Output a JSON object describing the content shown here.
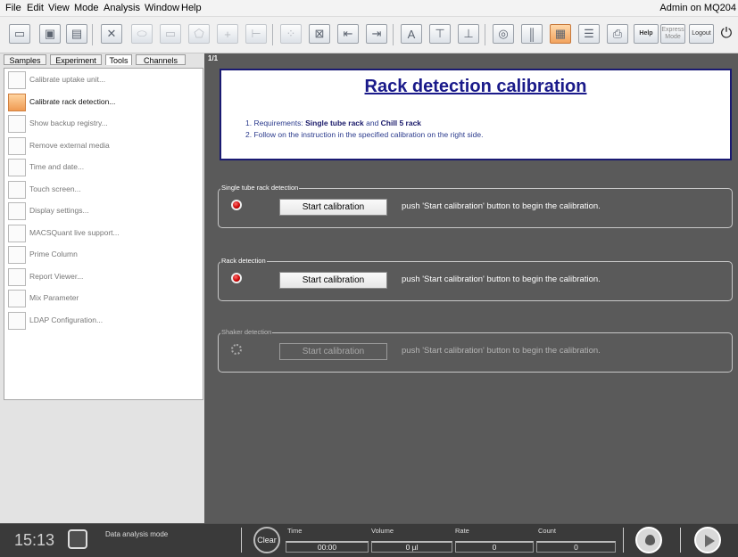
{
  "menu": {
    "items": [
      "File",
      "Edit",
      "View",
      "Mode",
      "Analysis",
      "Window",
      "Help"
    ],
    "user": "Admin on MQ204"
  },
  "toolbar": {
    "help_label": "Help",
    "express_label": "Express Mode",
    "logout_label": "Logout"
  },
  "tabs": [
    {
      "label": "Samples",
      "selected": false
    },
    {
      "label": "Experiment",
      "selected": false
    },
    {
      "label": "Tools",
      "selected": true
    },
    {
      "label": "Channels",
      "selected": false
    }
  ],
  "tools": [
    {
      "label": "Calibrate uptake unit...",
      "selected": false
    },
    {
      "label": "Calibrate rack detection...",
      "selected": true
    },
    {
      "label": "Show backup registry...",
      "selected": false
    },
    {
      "label": "Remove external media",
      "selected": false
    },
    {
      "label": "Time and date...",
      "selected": false
    },
    {
      "label": "Touch screen...",
      "selected": false
    },
    {
      "label": "Display settings...",
      "selected": false
    },
    {
      "label": "MACSQuant live support...",
      "selected": false
    },
    {
      "label": "Prime Column",
      "selected": false
    },
    {
      "label": "Report Viewer...",
      "selected": false
    },
    {
      "label": "Mix Parameter",
      "selected": false
    },
    {
      "label": "LDAP Configuration...",
      "selected": false
    }
  ],
  "main": {
    "page": "1/1",
    "title": "Rack detection calibration",
    "req_prefix": "1. Requirements: ",
    "req_item1": "Single tube rack",
    "req_and": " and ",
    "req_item2": "Chill 5 rack",
    "step2": "2. Follow on the instruction in the specified calibration on the right side.",
    "groups": [
      {
        "title": "Single tube rack detection",
        "button": "Start calibration",
        "message": "push 'Start calibration' button to begin the calibration.",
        "enabled": true
      },
      {
        "title": "Rack detection",
        "button": "Start calibration",
        "message": "push 'Start calibration' button to begin the calibration.",
        "enabled": true
      },
      {
        "title": "Shaker detection",
        "button": "Start calibration",
        "message": "push 'Start calibration' button to begin the calibration.",
        "enabled": false
      }
    ]
  },
  "status": {
    "time": "15:13",
    "mode": "Data analysis mode",
    "clear": "Clear",
    "meters": [
      {
        "label": "Time",
        "value": "00:00"
      },
      {
        "label": "Volume",
        "value": "0 µl"
      },
      {
        "label": "Rate",
        "value": "0"
      },
      {
        "label": "Count",
        "value": "0"
      }
    ]
  },
  "colors": {
    "accent": "#f2a35e",
    "title_blue": "#1a1a8a",
    "led_red": "#c70000",
    "main_bg": "#5a5a5a"
  }
}
